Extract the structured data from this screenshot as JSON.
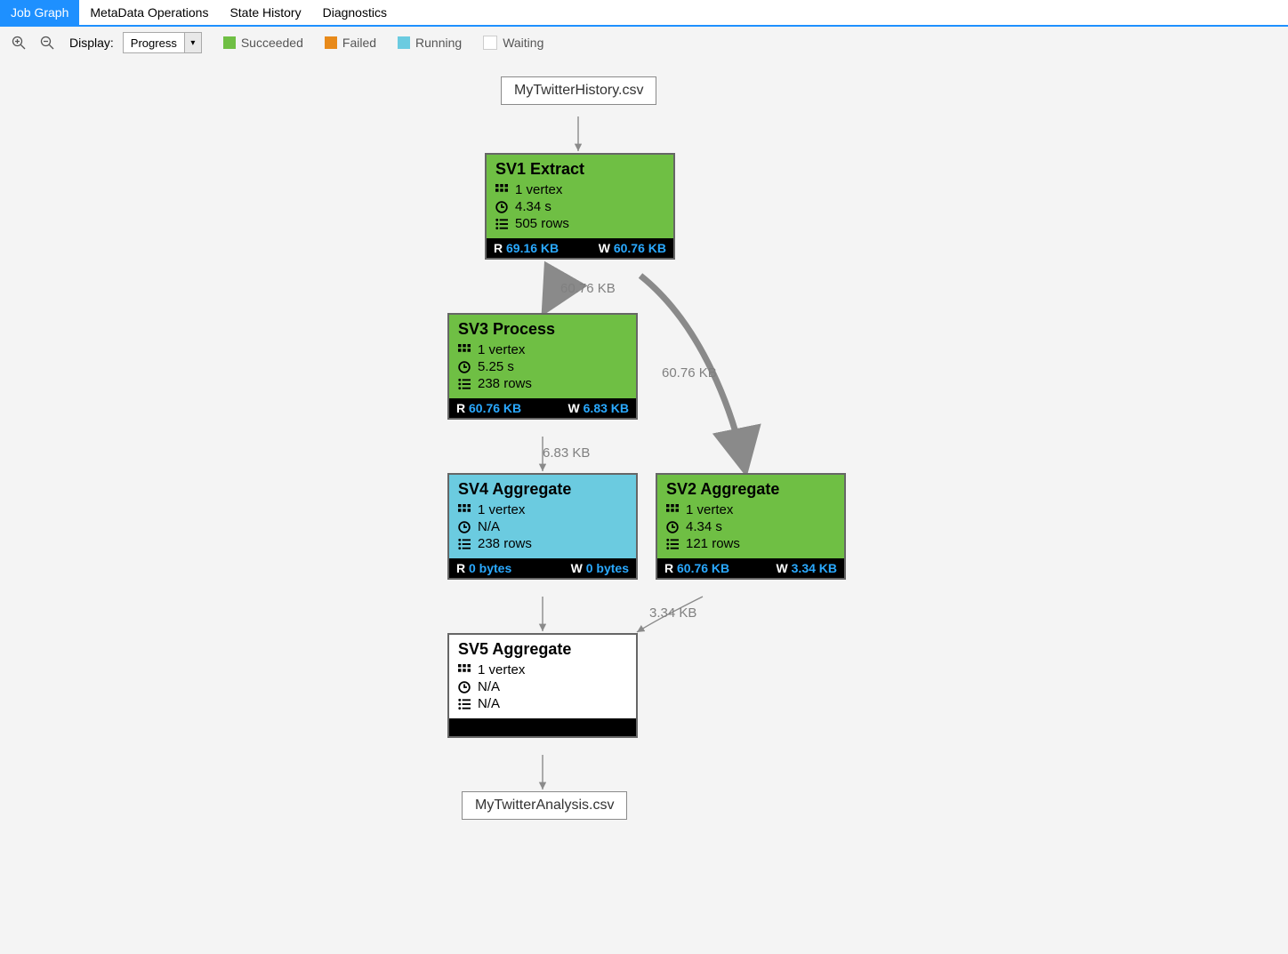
{
  "tabs": {
    "job_graph": "Job Graph",
    "metadata": "MetaData Operations",
    "state_history": "State History",
    "diagnostics": "Diagnostics"
  },
  "toolbar": {
    "display_label": "Display:",
    "display_value": "Progress",
    "legend": {
      "succeeded": "Succeeded",
      "failed": "Failed",
      "running": "Running",
      "waiting": "Waiting"
    },
    "colors": {
      "succeeded": "#6fbf44",
      "failed": "#e88a1a",
      "running": "#6bcbe0",
      "waiting": "#ffffff"
    }
  },
  "graph": {
    "input_file": "MyTwitterHistory.csv",
    "output_file": "MyTwitterAnalysis.csv",
    "edges": {
      "sv1_sv3": "60.76 KB",
      "sv1_sv2": "60.76 KB",
      "sv3_sv4": "6.83 KB",
      "sv2_sv5": "3.34 KB"
    },
    "sv1": {
      "title": "SV1 Extract",
      "vertex": "1 vertex",
      "time": "4.34 s",
      "rows": "505 rows",
      "read": "69.16 KB",
      "write": "60.76 KB"
    },
    "sv3": {
      "title": "SV3 Process",
      "vertex": "1 vertex",
      "time": "5.25 s",
      "rows": "238 rows",
      "read": "60.76 KB",
      "write": "6.83 KB"
    },
    "sv4": {
      "title": "SV4 Aggregate",
      "vertex": "1 vertex",
      "time": "N/A",
      "rows": "238 rows",
      "read": "0 bytes",
      "write": "0 bytes"
    },
    "sv2": {
      "title": "SV2 Aggregate",
      "vertex": "1 vertex",
      "time": "4.34 s",
      "rows": "121 rows",
      "read": "60.76 KB",
      "write": "3.34 KB"
    },
    "sv5": {
      "title": "SV5 Aggregate",
      "vertex": "1 vertex",
      "time": "N/A",
      "rows": "N/A"
    }
  }
}
